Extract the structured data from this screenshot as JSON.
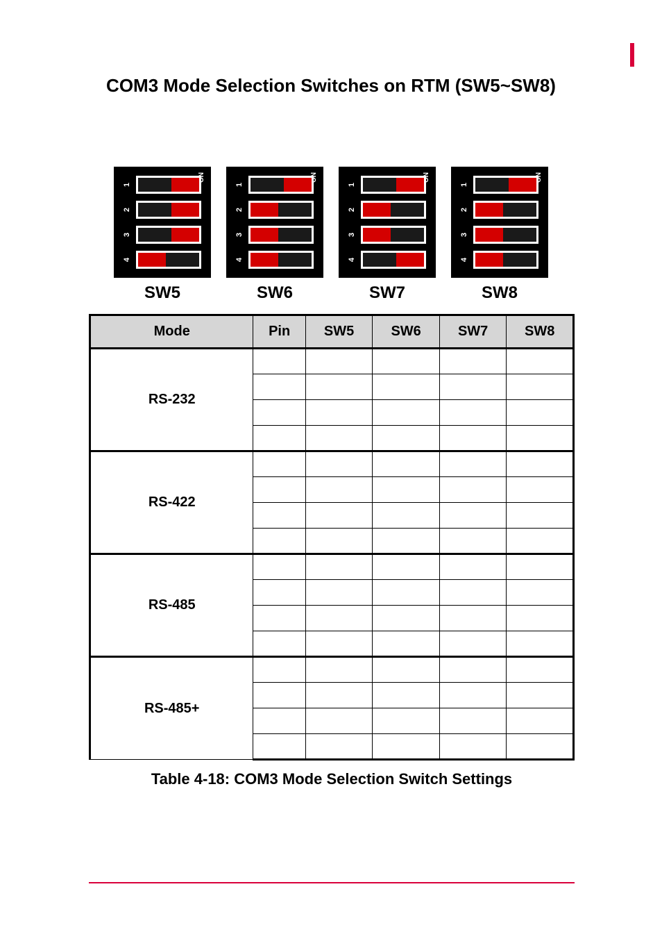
{
  "title": "COM3 Mode Selection Switches on RTM (SW5~SW8)",
  "switches": {
    "on_label": "ON",
    "pins": [
      "1",
      "2",
      "3",
      "4"
    ],
    "items": [
      {
        "name": "SW5",
        "positions": [
          "right",
          "right",
          "right",
          "left"
        ]
      },
      {
        "name": "SW6",
        "positions": [
          "right",
          "left",
          "left",
          "left"
        ]
      },
      {
        "name": "SW7",
        "positions": [
          "right",
          "left",
          "left",
          "right"
        ]
      },
      {
        "name": "SW8",
        "positions": [
          "right",
          "left",
          "left",
          "left"
        ]
      }
    ]
  },
  "table": {
    "headers": {
      "mode": "Mode",
      "pin": "Pin",
      "sw5": "SW5",
      "sw6": "SW6",
      "sw7": "SW7",
      "sw8": "SW8"
    },
    "modes": [
      {
        "name": "RS-232",
        "rows": [
          {
            "pin": "",
            "sw5": "",
            "sw6": "",
            "sw7": "",
            "sw8": ""
          },
          {
            "pin": "",
            "sw5": "",
            "sw6": "",
            "sw7": "",
            "sw8": ""
          },
          {
            "pin": "",
            "sw5": "",
            "sw6": "",
            "sw7": "",
            "sw8": ""
          },
          {
            "pin": "",
            "sw5": "",
            "sw6": "",
            "sw7": "",
            "sw8": ""
          }
        ]
      },
      {
        "name": "RS-422",
        "rows": [
          {
            "pin": "",
            "sw5": "",
            "sw6": "",
            "sw7": "",
            "sw8": ""
          },
          {
            "pin": "",
            "sw5": "",
            "sw6": "",
            "sw7": "",
            "sw8": ""
          },
          {
            "pin": "",
            "sw5": "",
            "sw6": "",
            "sw7": "",
            "sw8": ""
          },
          {
            "pin": "",
            "sw5": "",
            "sw6": "",
            "sw7": "",
            "sw8": ""
          }
        ]
      },
      {
        "name": "RS-485",
        "rows": [
          {
            "pin": "",
            "sw5": "",
            "sw6": "",
            "sw7": "",
            "sw8": ""
          },
          {
            "pin": "",
            "sw5": "",
            "sw6": "",
            "sw7": "",
            "sw8": ""
          },
          {
            "pin": "",
            "sw5": "",
            "sw6": "",
            "sw7": "",
            "sw8": ""
          },
          {
            "pin": "",
            "sw5": "",
            "sw6": "",
            "sw7": "",
            "sw8": ""
          }
        ]
      },
      {
        "name": "RS-485+",
        "rows": [
          {
            "pin": "",
            "sw5": "",
            "sw6": "",
            "sw7": "",
            "sw8": ""
          },
          {
            "pin": "",
            "sw5": "",
            "sw6": "",
            "sw7": "",
            "sw8": ""
          },
          {
            "pin": "",
            "sw5": "",
            "sw6": "",
            "sw7": "",
            "sw8": ""
          },
          {
            "pin": "",
            "sw5": "",
            "sw6": "",
            "sw7": "",
            "sw8": ""
          }
        ]
      }
    ]
  },
  "caption": "Table 4-18: COM3 Mode Selection Switch Settings"
}
